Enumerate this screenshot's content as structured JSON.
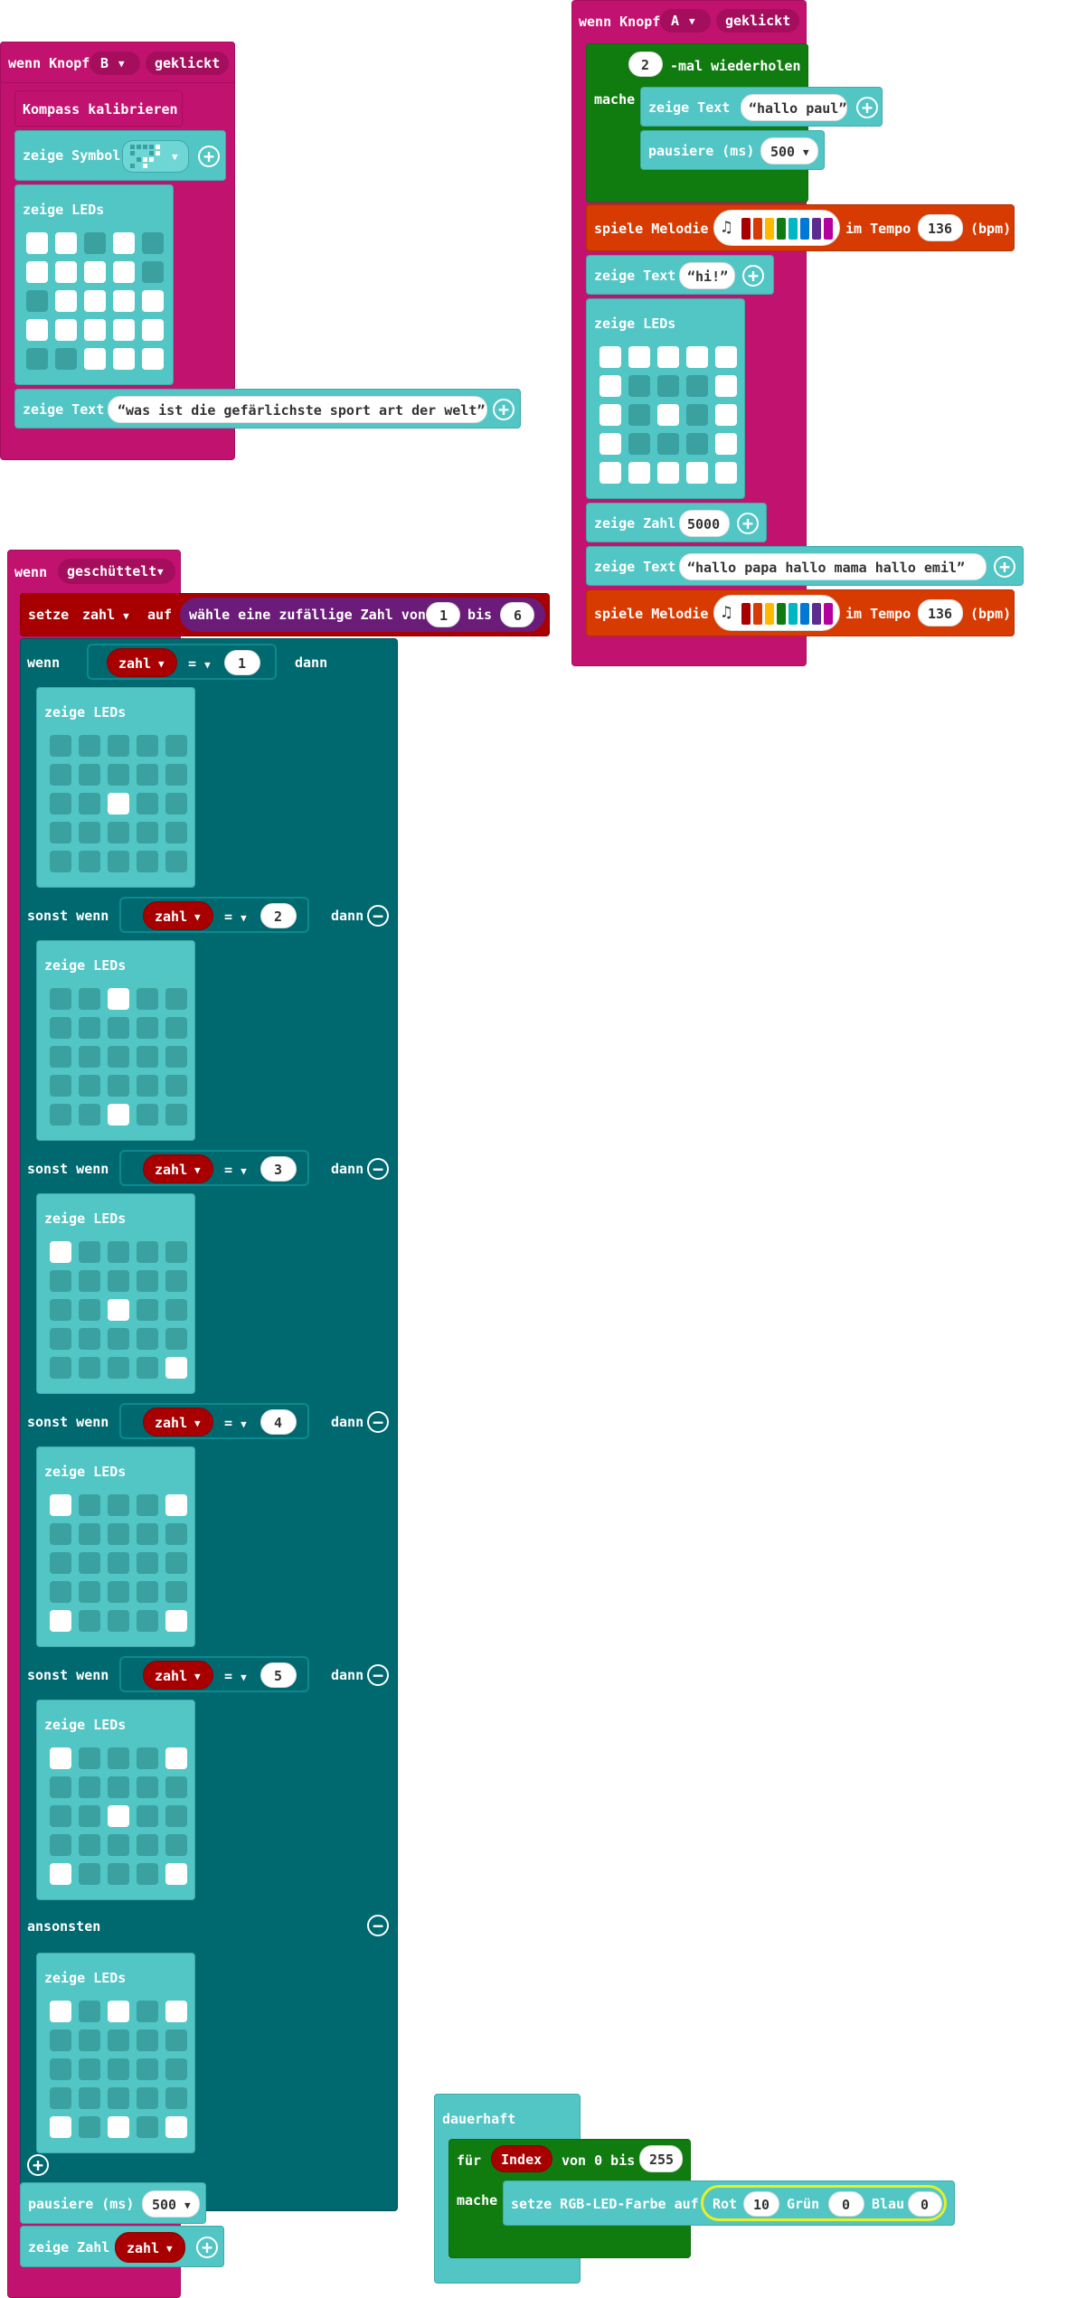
{
  "colors": {
    "events": "#c2126f",
    "basic": "#52c5c5",
    "logic": "#006970",
    "loops": "#107c10",
    "music": "#d83b01",
    "variables": "#a80000",
    "math": "#6b1c78"
  },
  "icons": [
    "dropdown-arrow-icon",
    "plus-icon",
    "minus-icon",
    "music-note-icon"
  ],
  "blockB": {
    "wenn": "wenn Knopf",
    "button": "B",
    "geklickt": "geklickt",
    "calibrate": "Kompass kalibrieren",
    "zeige_symbol": "zeige Symbol",
    "zeige_leds": "zeige LEDs",
    "zeige_text": "zeige Text",
    "text_value": "was ist die gefärlichste sport art der welt"
  },
  "blockA": {
    "wenn": "wenn Knopf",
    "button": "A",
    "geklickt": "geklickt",
    "repeat_count": "2",
    "repeat_label": "-mal wiederholen",
    "mache": "mache",
    "zeige_text": "zeige Text",
    "text1": "hallo paul",
    "pausiere": "pausiere (ms)",
    "pause_value": "500",
    "spiele_melodie": "spiele Melodie",
    "im_tempo": "im Tempo",
    "tempo": "136",
    "bpm": "(bpm)",
    "text2": "hi!",
    "zeige_leds": "zeige LEDs",
    "zeige_zahl": "zeige Zahl",
    "zahl_value": "5000",
    "text3": "hallo papa  hallo mama  hallo emil",
    "tempo2": "136"
  },
  "blockShake": {
    "wenn": "wenn",
    "event": "geschüttelt",
    "setze": "setze",
    "var": "zahl",
    "auf": "auf",
    "random_label": "wähle eine zufällige Zahl von",
    "von": "1",
    "bis": "bis",
    "bis_value": "6",
    "if_label": "wenn",
    "eq": "=",
    "dann": "dann",
    "sonst_wenn": "sonst wenn",
    "ansonsten": "ansonsten",
    "cmp_values": [
      "1",
      "2",
      "3",
      "4",
      "5"
    ],
    "zeige_leds": "zeige LEDs",
    "pausiere": "pausiere (ms)",
    "pause_value": "500",
    "zeige_zahl": "zeige Zahl",
    "zahl_var": "zahl"
  },
  "blockForever": {
    "title": "dauerhaft",
    "fuer": "für",
    "index": "Index",
    "von": "von 0 bis",
    "bis_value": "255",
    "mache": "mache",
    "setze_rgb": "setze RGB-LED-Farbe auf",
    "rot": "Rot",
    "rot_value": "10",
    "gruen": "Grün",
    "gruen_value": "0",
    "blau": "Blau",
    "blau_value": "0"
  },
  "led_grids": {
    "b_leds": [
      [
        1,
        1,
        0,
        1,
        0
      ],
      [
        1,
        1,
        1,
        1,
        0
      ],
      [
        0,
        1,
        1,
        1,
        1
      ],
      [
        1,
        1,
        1,
        1,
        1
      ],
      [
        0,
        0,
        1,
        1,
        1
      ]
    ],
    "a_leds": [
      [
        1,
        1,
        1,
        1,
        1
      ],
      [
        1,
        0,
        0,
        0,
        1
      ],
      [
        1,
        0,
        1,
        0,
        1
      ],
      [
        1,
        0,
        0,
        0,
        1
      ],
      [
        1,
        1,
        1,
        1,
        1
      ]
    ],
    "shake": [
      [
        [
          0,
          0,
          0,
          0,
          0
        ],
        [
          0,
          0,
          0,
          0,
          0
        ],
        [
          0,
          0,
          1,
          0,
          0
        ],
        [
          0,
          0,
          0,
          0,
          0
        ],
        [
          0,
          0,
          0,
          0,
          0
        ]
      ],
      [
        [
          0,
          0,
          1,
          0,
          0
        ],
        [
          0,
          0,
          0,
          0,
          0
        ],
        [
          0,
          0,
          0,
          0,
          0
        ],
        [
          0,
          0,
          0,
          0,
          0
        ],
        [
          0,
          0,
          1,
          0,
          0
        ]
      ],
      [
        [
          1,
          0,
          0,
          0,
          0
        ],
        [
          0,
          0,
          0,
          0,
          0
        ],
        [
          0,
          0,
          1,
          0,
          0
        ],
        [
          0,
          0,
          0,
          0,
          0
        ],
        [
          0,
          0,
          0,
          0,
          1
        ]
      ],
      [
        [
          1,
          0,
          0,
          0,
          1
        ],
        [
          0,
          0,
          0,
          0,
          0
        ],
        [
          0,
          0,
          0,
          0,
          0
        ],
        [
          0,
          0,
          0,
          0,
          0
        ],
        [
          1,
          0,
          0,
          0,
          1
        ]
      ],
      [
        [
          1,
          0,
          0,
          0,
          1
        ],
        [
          0,
          0,
          0,
          0,
          0
        ],
        [
          0,
          0,
          1,
          0,
          0
        ],
        [
          0,
          0,
          0,
          0,
          0
        ],
        [
          1,
          0,
          0,
          0,
          1
        ]
      ],
      [
        [
          1,
          0,
          1,
          0,
          1
        ],
        [
          0,
          0,
          0,
          0,
          0
        ],
        [
          0,
          0,
          0,
          0,
          0
        ],
        [
          0,
          0,
          0,
          0,
          0
        ],
        [
          1,
          0,
          1,
          0,
          1
        ]
      ]
    ]
  },
  "melody_colors": [
    "#a80000",
    "#d83b01",
    "#ffb900",
    "#107c10",
    "#00b7c3",
    "#0078d4",
    "#5c2d91",
    "#b4009e"
  ]
}
